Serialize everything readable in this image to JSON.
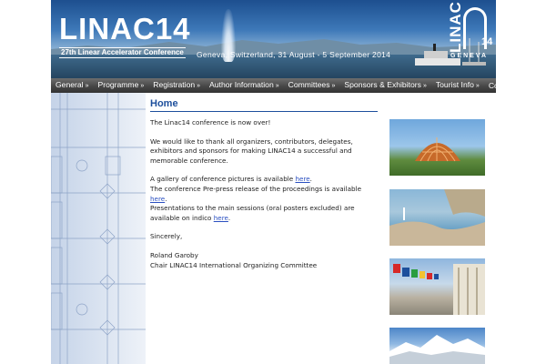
{
  "banner": {
    "title": "LINAC14",
    "subtitle": "27th Linear Accelerator Conference",
    "location": "Geneva, Switzerland, 31 August - 5 September 2014",
    "logo_text": "LINAC",
    "logo_number": "14",
    "logo_city": "GENEVA"
  },
  "nav": {
    "items": [
      {
        "label": "General",
        "arrow": "»"
      },
      {
        "label": "Programme",
        "arrow": "»"
      },
      {
        "label": "Registration",
        "arrow": "»"
      },
      {
        "label": "Author Information",
        "arrow": "»"
      },
      {
        "label": "Committees",
        "arrow": "»"
      },
      {
        "label": "Sponsors & Exhibitors",
        "arrow": "»"
      },
      {
        "label": "Tourist Info",
        "arrow": "»"
      },
      {
        "label": "Contact",
        "arrow": ""
      }
    ]
  },
  "content": {
    "page_title": "Home",
    "p1": "The Linac14 conference is now over!",
    "p2": "We would like to thank all organizers, contributors, delegates, exhibitors and sponsors for making LINAC14 a successful and memorable conference.",
    "p3_a": "A gallery of conference pictures is available ",
    "p3_link": "here",
    "p3_b": ".",
    "p4_a": "The conference Pre-press release of the proceedings is available ",
    "p4_link": "here",
    "p4_b": ".",
    "p5_a": "Presentations to the main sessions (oral posters excluded) are available on indico ",
    "p5_link": "here",
    "p5_b": ".",
    "sincerely": "Sincerely,",
    "signer_name": "Roland Garoby",
    "signer_title": "Chair LINAC14 International Organizing Committee"
  },
  "colors": {
    "accent": "#1d4f9c",
    "link": "#2a4fc0",
    "nav_bg": "#474747"
  }
}
